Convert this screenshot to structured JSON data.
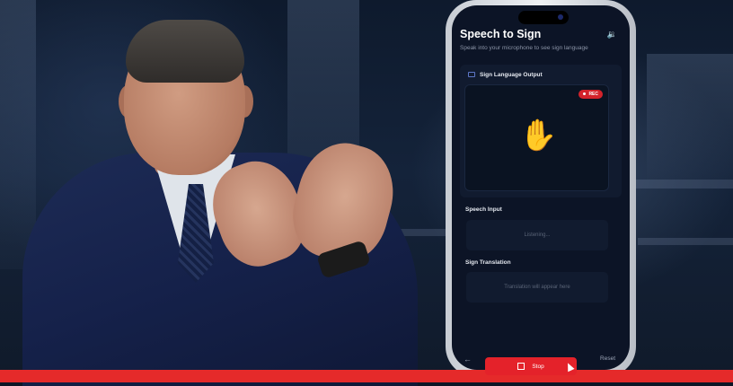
{
  "app": {
    "title": "Speech to Sign",
    "subtitle": "Speak into your microphone to see sign language"
  },
  "output_card": {
    "heading": "Sign Language Output",
    "rec_badge": "REC",
    "sign_emoji": "✋"
  },
  "speech_input": {
    "label": "Speech Input",
    "status": "Listening..."
  },
  "sign_translation": {
    "label": "Sign Translation",
    "placeholder": "Translation will appear here"
  },
  "controls": {
    "back_icon": "←",
    "stop_label": "Stop",
    "reset_label": "Reset"
  },
  "colors": {
    "accent_red": "#e52a2a",
    "screen_bg": "#0c1426",
    "card_bg": "#111b2f"
  }
}
